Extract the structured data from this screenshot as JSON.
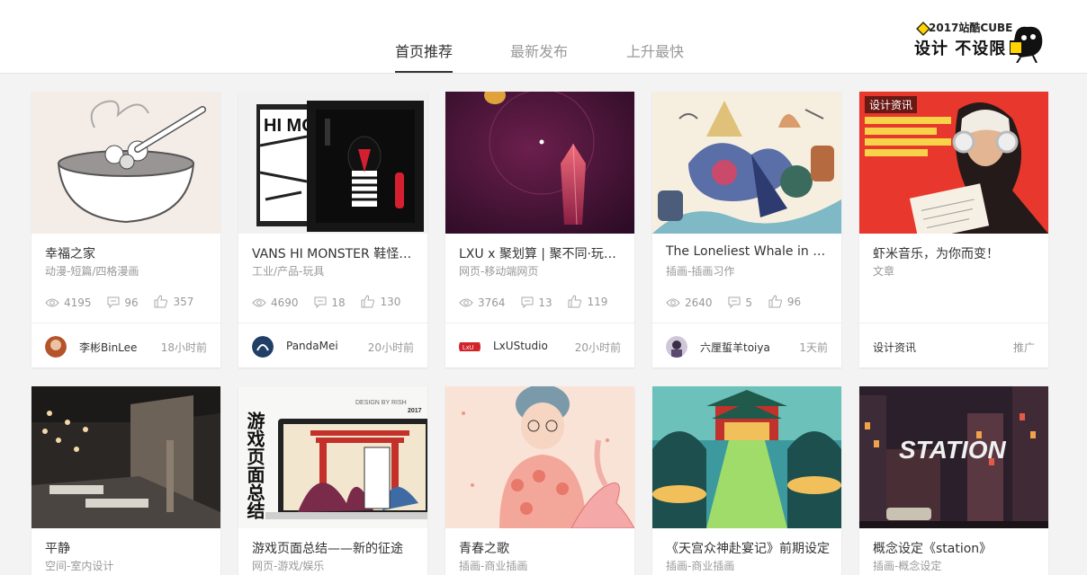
{
  "nav": {
    "tabs": [
      "首页推荐",
      "最新发布",
      "上升最快"
    ],
    "promo_line1": "2017站酷CUBE",
    "promo_line2": "设计 不设限"
  },
  "cards": [
    {
      "title": "幸福之家",
      "category": "动漫-短篇/四格漫画",
      "views": "4195",
      "comments": "96",
      "likes": "357",
      "author": "李彬BinLee",
      "time": "18小时前"
    },
    {
      "title": "VANS HI MONSTER 鞋怪潮玩",
      "category": "工业/产品-玩具",
      "views": "4690",
      "comments": "18",
      "likes": "130",
      "author": "PandaMei",
      "time": "20小时前"
    },
    {
      "title": "LXU x 聚划算 | 聚不同·玩出新",
      "category": "网页-移动端网页",
      "views": "3764",
      "comments": "13",
      "likes": "119",
      "author": "LxUStudio",
      "time": "20小时前"
    },
    {
      "title": "The Loneliest Whale in the World",
      "category": "插画-插画习作",
      "views": "2640",
      "comments": "5",
      "likes": "96",
      "author": "六厘蜇羊toiya",
      "time": "1天前"
    },
    {
      "title": "虾米音乐，为你而变！",
      "category": "文章",
      "author": "设计资讯",
      "time": "推广",
      "tag": "设计资讯"
    },
    {
      "title": "平静",
      "category": "空间-室内设计"
    },
    {
      "title": "游戏页面总结——新的征途",
      "category": "网页-游戏/娱乐"
    },
    {
      "title": "青春之歌",
      "category": "插画-商业插画"
    },
    {
      "title": "《天宫众神赴宴记》前期设定",
      "category": "插画-商业插画"
    },
    {
      "title": "概念设定《station》",
      "category": "插画-概念设定"
    }
  ],
  "thumb_text": {
    "c2": "HI MO",
    "c3_badge": "LxU",
    "c6_vertical": "游戏页面总结",
    "c6_design": "DESIGN BY RISH",
    "c6_year": "2017",
    "c10": "STATION"
  },
  "colors": {
    "accent": "#333333",
    "muted": "#999999",
    "card_bg": "#ffffff",
    "page_bg": "#f3f3f3"
  }
}
